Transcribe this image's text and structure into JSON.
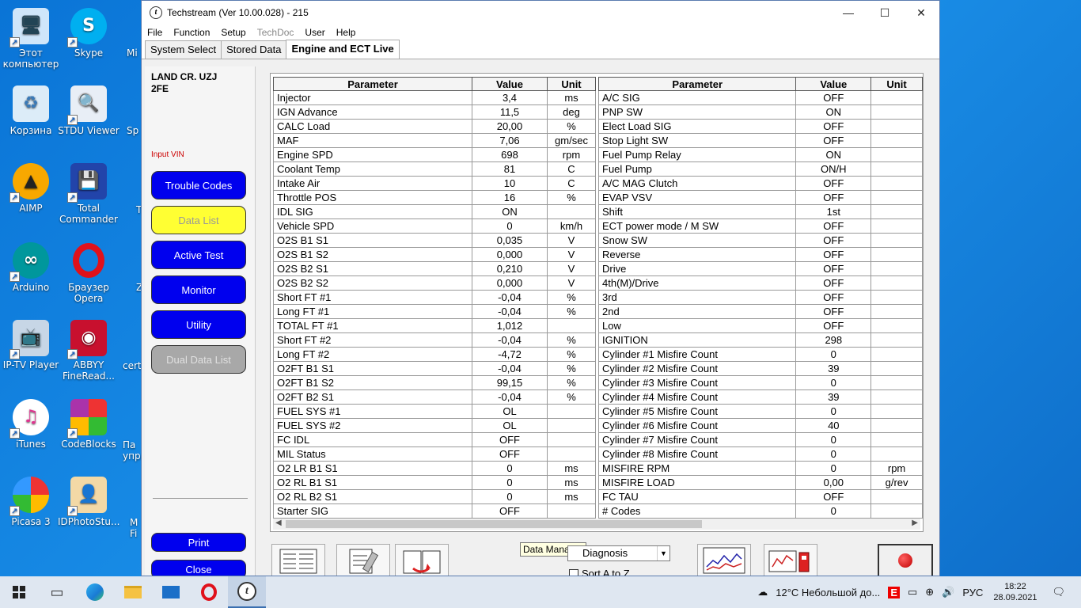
{
  "desktop": {
    "icons": [
      {
        "label": "Этот компьютер"
      },
      {
        "label": "Корзина"
      },
      {
        "label": "AIMP"
      },
      {
        "label": "Arduino"
      },
      {
        "label": "IP-TV Player"
      },
      {
        "label": "iTunes"
      },
      {
        "label": "Picasa 3"
      },
      {
        "label": "Skype"
      },
      {
        "label": "STDU Viewer"
      },
      {
        "label": "Total Commander"
      },
      {
        "label": "Браузер Opera"
      },
      {
        "label": "ABBYY FineRead..."
      },
      {
        "label": "CodeBlocks"
      },
      {
        "label": "IDPhotoStu..."
      }
    ],
    "partial_labels": [
      "Mi",
      "Sp",
      "T",
      "Z",
      "certi",
      "Па упра",
      "M Fi"
    ]
  },
  "window": {
    "title": "Techstream (Ver 10.00.028) - 215",
    "app_icon": "t",
    "menu": [
      "File",
      "Function",
      "Setup",
      "TechDoc",
      "User",
      "Help"
    ],
    "tabs": [
      "System Select",
      "Stored Data",
      "Engine and ECT Live"
    ]
  },
  "sidebar": {
    "vehicle_line1": "LAND CR. UZJ",
    "vehicle_line2": "2FE",
    "input_vin": "Input VIN",
    "buttons": [
      "Trouble Codes",
      "Data List",
      "Active Test",
      "Monitor",
      "Utility",
      "Dual Data List"
    ],
    "print": "Print",
    "close": "Close"
  },
  "table": {
    "headers": [
      "Parameter",
      "Value",
      "Unit"
    ],
    "left": [
      [
        "Injector",
        "3,4",
        "ms"
      ],
      [
        "IGN Advance",
        "11,5",
        "deg"
      ],
      [
        "CALC Load",
        "20,00",
        "%"
      ],
      [
        "MAF",
        "7,06",
        "gm/sec"
      ],
      [
        "Engine SPD",
        "698",
        "rpm"
      ],
      [
        "Coolant Temp",
        "81",
        "C"
      ],
      [
        "Intake Air",
        "10",
        "C"
      ],
      [
        "Throttle POS",
        "16",
        "%"
      ],
      [
        "IDL SIG",
        "ON",
        ""
      ],
      [
        "Vehicle SPD",
        "0",
        "km/h"
      ],
      [
        "O2S B1 S1",
        "0,035",
        "V"
      ],
      [
        "O2S B1 S2",
        "0,000",
        "V"
      ],
      [
        "O2S B2 S1",
        "0,210",
        "V"
      ],
      [
        "O2S B2 S2",
        "0,000",
        "V"
      ],
      [
        "Short FT #1",
        "-0,04",
        "%"
      ],
      [
        "Long FT #1",
        "-0,04",
        "%"
      ],
      [
        "TOTAL FT #1",
        "1,012",
        ""
      ],
      [
        "Short FT #2",
        "-0,04",
        "%"
      ],
      [
        "Long FT #2",
        "-4,72",
        "%"
      ],
      [
        "O2FT B1 S1",
        "-0,04",
        "%"
      ],
      [
        "O2FT B1 S2",
        "99,15",
        "%"
      ],
      [
        "O2FT B2 S1",
        "-0,04",
        "%"
      ],
      [
        "FUEL SYS #1",
        "OL",
        ""
      ],
      [
        "FUEL SYS #2",
        "OL",
        ""
      ],
      [
        "FC IDL",
        "OFF",
        ""
      ],
      [
        "MIL Status",
        "OFF",
        ""
      ],
      [
        "O2 LR B1 S1",
        "0",
        "ms"
      ],
      [
        "O2 RL B1 S1",
        "0",
        "ms"
      ],
      [
        "O2 RL B2 S1",
        "0",
        "ms"
      ],
      [
        "Starter SIG",
        "OFF",
        ""
      ]
    ],
    "right": [
      [
        "A/C SIG",
        "OFF",
        ""
      ],
      [
        "PNP SW",
        "ON",
        ""
      ],
      [
        "Elect Load SIG",
        "OFF",
        ""
      ],
      [
        "Stop Light SW",
        "OFF",
        ""
      ],
      [
        "Fuel Pump Relay",
        "ON",
        ""
      ],
      [
        "Fuel Pump",
        "ON/H",
        ""
      ],
      [
        "A/C MAG Clutch",
        "OFF",
        ""
      ],
      [
        "EVAP VSV",
        "OFF",
        ""
      ],
      [
        "Shift",
        "1st",
        ""
      ],
      [
        "ECT power mode / M SW",
        "OFF",
        ""
      ],
      [
        "Snow SW",
        "OFF",
        ""
      ],
      [
        "Reverse",
        "OFF",
        ""
      ],
      [
        "Drive",
        "OFF",
        ""
      ],
      [
        "4th(M)/Drive",
        "OFF",
        ""
      ],
      [
        "3rd",
        "OFF",
        ""
      ],
      [
        "2nd",
        "OFF",
        ""
      ],
      [
        "Low",
        "OFF",
        ""
      ],
      [
        "IGNITION",
        "298",
        ""
      ],
      [
        "Cylinder #1 Misfire Count",
        "0",
        ""
      ],
      [
        "Cylinder #2 Misfire Count",
        "39",
        ""
      ],
      [
        "Cylinder #3 Misfire Count",
        "0",
        ""
      ],
      [
        "Cylinder #4 Misfire Count",
        "39",
        ""
      ],
      [
        "Cylinder #5 Misfire Count",
        "0",
        ""
      ],
      [
        "Cylinder #6 Misfire Count",
        "40",
        ""
      ],
      [
        "Cylinder #7 Misfire Count",
        "0",
        ""
      ],
      [
        "Cylinder #8 Misfire Count",
        "0",
        ""
      ],
      [
        "MISFIRE RPM",
        "0",
        "rpm"
      ],
      [
        "MISFIRE LOAD",
        "0,00",
        "g/rev"
      ],
      [
        "FC TAU",
        "OFF",
        ""
      ],
      [
        "# Codes",
        "0",
        ""
      ]
    ]
  },
  "toolbar": {
    "tooltip": "Data Manager",
    "combo_value": "Diagnosis",
    "sort_label": "Sort A to Z"
  },
  "taskbar": {
    "weather": "12°C  Небольшой до...",
    "lang": "РУС",
    "time": "18:22",
    "date": "28.09.2021"
  }
}
